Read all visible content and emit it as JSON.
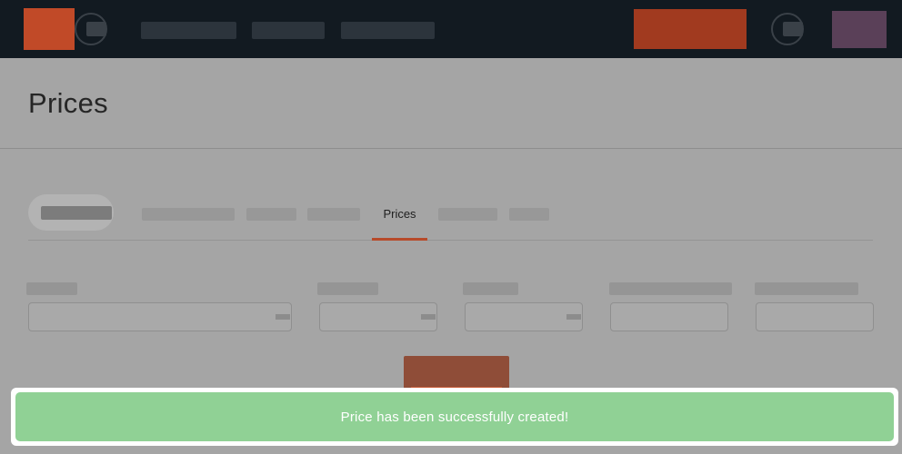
{
  "page": {
    "title": "Prices"
  },
  "tabs": {
    "active_label": "Prices"
  },
  "toast": {
    "message": "Price has been successfully created!"
  },
  "colors": {
    "topbar": "#121a21",
    "accent": "#c14a28",
    "avatar": "#5a4058",
    "toast_success": "#90d195"
  },
  "icons": {
    "top_left": "help-icon",
    "top_right": "notifications-icon"
  }
}
